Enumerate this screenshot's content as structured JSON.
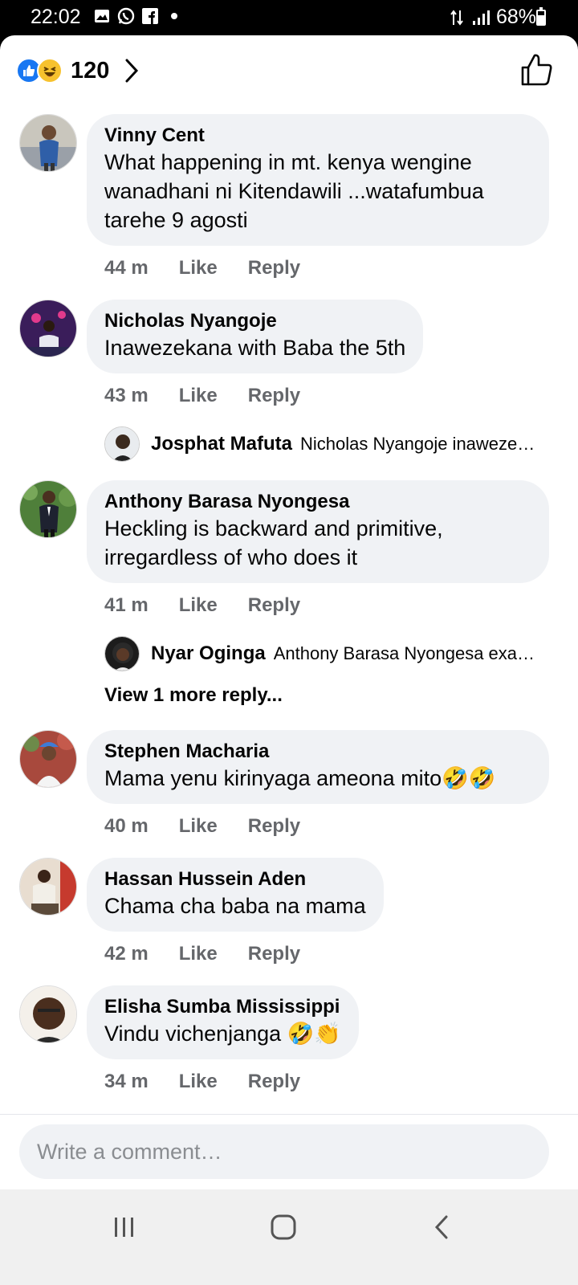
{
  "status_bar": {
    "time": "22:02",
    "battery": "68%",
    "battery_level": 0.68
  },
  "reactions": {
    "count": "120",
    "icons": [
      "like-icon",
      "haha-icon"
    ],
    "accent": "#1877f2"
  },
  "comments": [
    {
      "author": "Vinny Cent",
      "text": "What happening in mt. kenya wengine wanadhani ni Kitendawili ...watafumbua tarehe 9 agosti",
      "time": "44 m",
      "like": "Like",
      "reply": "Reply"
    },
    {
      "author": "Nicholas Nyangoje",
      "text": "Inawezekana with Baba the 5th",
      "time": "43 m",
      "like": "Like",
      "reply": "Reply",
      "replies": [
        {
          "author": "Josphat Mafuta",
          "snippet": "Nicholas Nyangoje inaweze…"
        }
      ]
    },
    {
      "author": "Anthony Barasa Nyongesa",
      "text": "Heckling is backward and primitive, irregardless of who does it",
      "time": "41 m",
      "like": "Like",
      "reply": "Reply",
      "replies": [
        {
          "author": "Nyar Oginga",
          "snippet": "Anthony Barasa Nyongesa exa…"
        }
      ],
      "view_more": "View 1 more reply..."
    },
    {
      "author": "Stephen Macharia",
      "text": "Mama yenu kirinyaga ameona mito🤣🤣",
      "time": "40 m",
      "like": "Like",
      "reply": "Reply"
    },
    {
      "author": "Hassan Hussein Aden",
      "text": "Chama cha baba na mama",
      "time": "42 m",
      "like": "Like",
      "reply": "Reply"
    },
    {
      "author": "Elisha Sumba Mississippi",
      "text": "Vindu vichenjanga 🤣👏",
      "time": "34 m",
      "like": "Like",
      "reply": "Reply"
    }
  ],
  "composer": {
    "placeholder": "Write a comment…"
  }
}
